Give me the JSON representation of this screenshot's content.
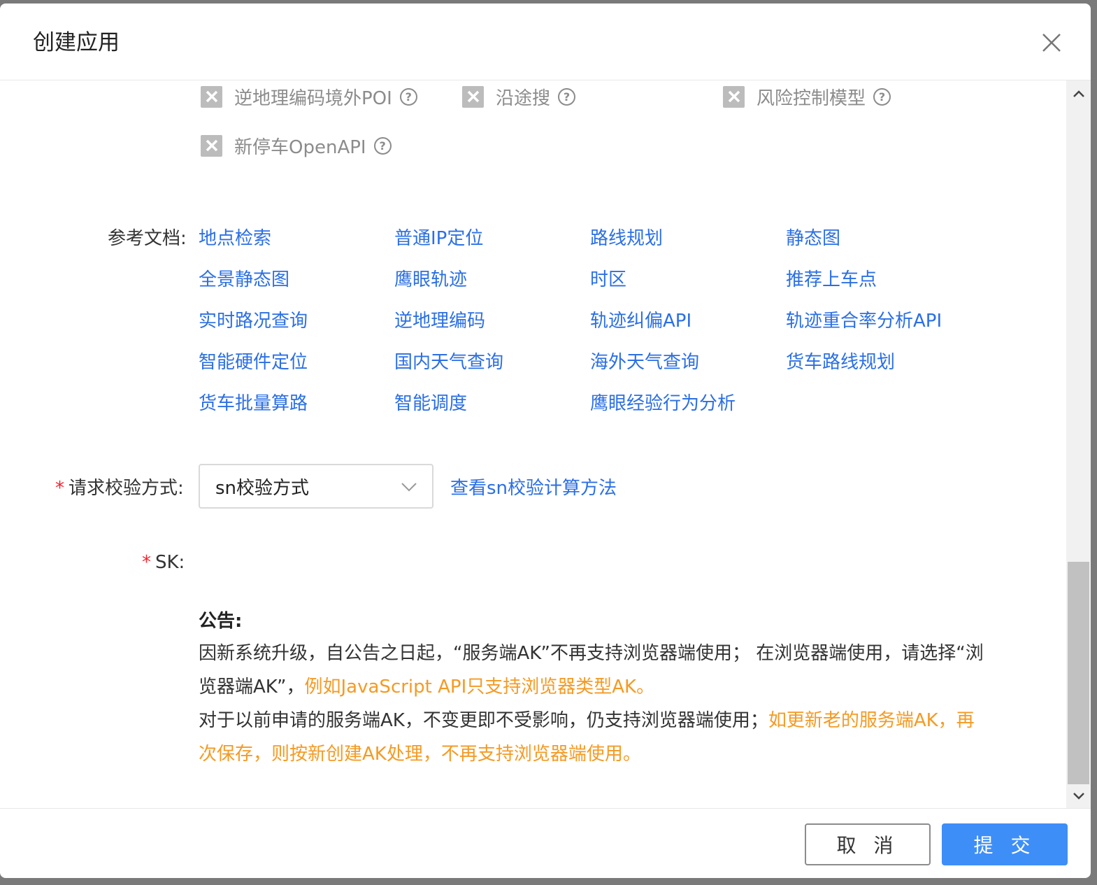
{
  "dialog": {
    "title": "创建应用"
  },
  "services": [
    {
      "label": "逆地理编码境外POI",
      "help": "?"
    },
    {
      "label": "沿途搜",
      "help": "?"
    },
    {
      "label": "风险控制模型",
      "help": "?"
    },
    {
      "label": "新停车OpenAPI",
      "help": "?"
    }
  ],
  "docs": {
    "label": "参考文档:",
    "links": [
      "地点检索",
      "普通IP定位",
      "路线规划",
      "静态图",
      "全景静态图",
      "鹰眼轨迹",
      "时区",
      "推荐上车点",
      "实时路况查询",
      "逆地理编码",
      "轨迹纠偏API",
      "轨迹重合率分析API",
      "智能硬件定位",
      "国内天气查询",
      "海外天气查询",
      "货车路线规划",
      "货车批量算路",
      "智能调度",
      "鹰眼经验行为分析"
    ]
  },
  "verify": {
    "required_mark": "*",
    "label": "请求校验方式:",
    "value": "sn校验方式",
    "help_link": "查看sn校验计算方法"
  },
  "sk": {
    "required_mark": "*",
    "label": "SK:"
  },
  "notice": {
    "title": "公告:",
    "p1_text": "因新系统升级，自公告之日起，“服务端AK”不再支持浏览器端使用； 在浏览器端使用，请选择“浏览器端AK”，",
    "p1_highlight": "例如JavaScript API只支持浏览器类型AK。",
    "p2_text": "对于以前申请的服务端AK，不变更即不受影响，仍支持浏览器端使用；",
    "p2_highlight": "如更新老的服务端AK，再次保存，则按新创建AK处理，不再支持浏览器端使用。"
  },
  "footer": {
    "cancel_label": "取 消",
    "submit_label": "提 交"
  },
  "colors": {
    "link": "#2b6fe6",
    "highlight": "#f59a23",
    "primary": "#3e8ef7",
    "required": "#f5222d"
  }
}
